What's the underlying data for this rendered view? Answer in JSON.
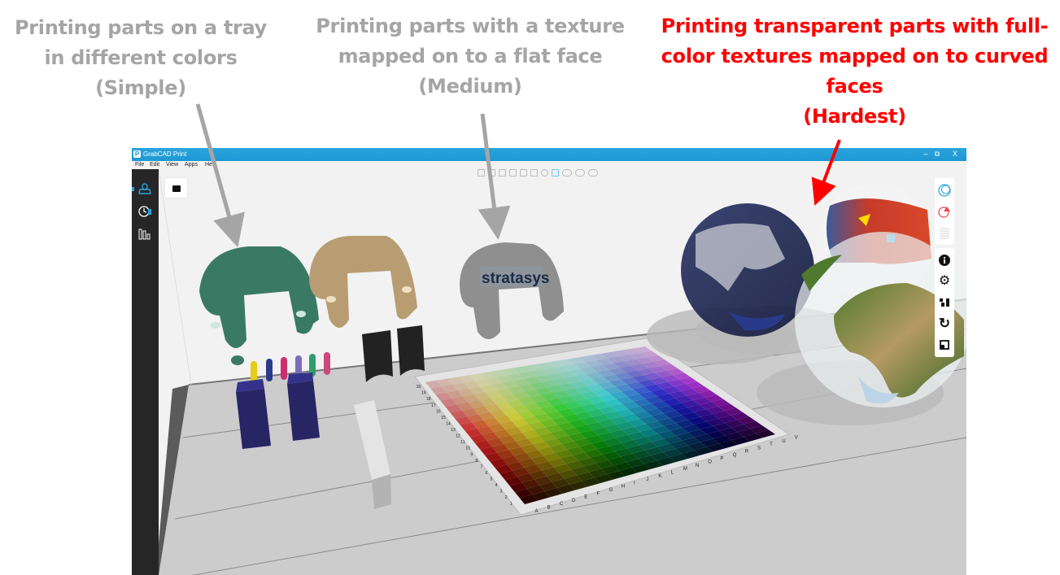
{
  "annotations": [
    {
      "id": "simple",
      "lines": [
        "Printing parts on a tray",
        "in different colors",
        "(Simple)"
      ],
      "color": "#a5a5a5"
    },
    {
      "id": "medium",
      "lines": [
        "Printing parts with a texture",
        "mapped on to a flat face",
        "(Medium)"
      ],
      "color": "#a5a5a5"
    },
    {
      "id": "hardest",
      "lines": [
        "Printing transparent parts with full-",
        "color textures mapped on to curved",
        "faces",
        "(Hardest)"
      ],
      "color": "#ff0000"
    }
  ],
  "app": {
    "title": "GrabCAD Print",
    "app_icon": "P",
    "window_controls": {
      "minimize": "–",
      "restore": "⧉",
      "close": "X"
    },
    "menu": [
      "File",
      "Edit",
      "View",
      "Apps",
      "Help"
    ],
    "left_sidebar": [
      {
        "name": "tray-icon",
        "glyph": "⌂",
        "active": true
      },
      {
        "name": "history-clock-icon",
        "glyph": "◷",
        "active": false
      },
      {
        "name": "reports-bars-icon",
        "glyph": "‖",
        "active": false
      }
    ],
    "view_toolbar": [
      "front-view",
      "back-view",
      "left-view",
      "right-view",
      "top-view",
      "bottom-view",
      "iso-view",
      "fit-view",
      "zoom-in",
      "zoom-settings",
      "zoom-area"
    ],
    "active_view": "fit-view",
    "right_panel": {
      "top": [
        {
          "name": "model-view-icon",
          "glyph": "◯",
          "color": "#29a3dc"
        },
        {
          "name": "warning-issues-icon",
          "glyph": "◔",
          "color": "#ef4444"
        },
        {
          "name": "slice-layers-icon",
          "glyph": "≡",
          "color": "#cfcfcf"
        }
      ],
      "bottom": [
        {
          "name": "info-icon",
          "glyph": "ⓘ",
          "color": "#111111"
        },
        {
          "name": "settings-gear-icon",
          "glyph": "⚙",
          "color": "#111111"
        },
        {
          "name": "arrange-icon",
          "glyph": "▚",
          "color": "#111111"
        },
        {
          "name": "rotate-icon",
          "glyph": "↻",
          "color": "#111111"
        },
        {
          "name": "scale-icon",
          "glyph": "◲",
          "color": "#111111"
        }
      ]
    },
    "scene": {
      "logo_text": "stratasys",
      "color_chart_columns": [
        "A",
        "B",
        "C",
        "D",
        "E",
        "F",
        "G",
        "H",
        "I",
        "J",
        "K",
        "L",
        "M",
        "N",
        "O",
        "P",
        "Q",
        "R",
        "S",
        "T",
        "U",
        "V"
      ],
      "color_chart_rows": [
        "1",
        "2",
        "3",
        "4",
        "5",
        "6",
        "7",
        "8",
        "9",
        "10",
        "11",
        "12",
        "13",
        "14",
        "15",
        "16",
        "17",
        "18",
        "19",
        "20"
      ],
      "part_colors": {
        "green_bracket": "#3a7a64",
        "tan_bracket": "#b89d72",
        "gray_bracket": "#8f8f8f",
        "navy_blocks": "#272564",
        "black_clips": "#222222",
        "rings": [
          "#e6cc12",
          "#2b3a8c",
          "#cc2f6d",
          "#7c6cb8",
          "#2f9c6e",
          "#c84a78"
        ]
      }
    }
  }
}
